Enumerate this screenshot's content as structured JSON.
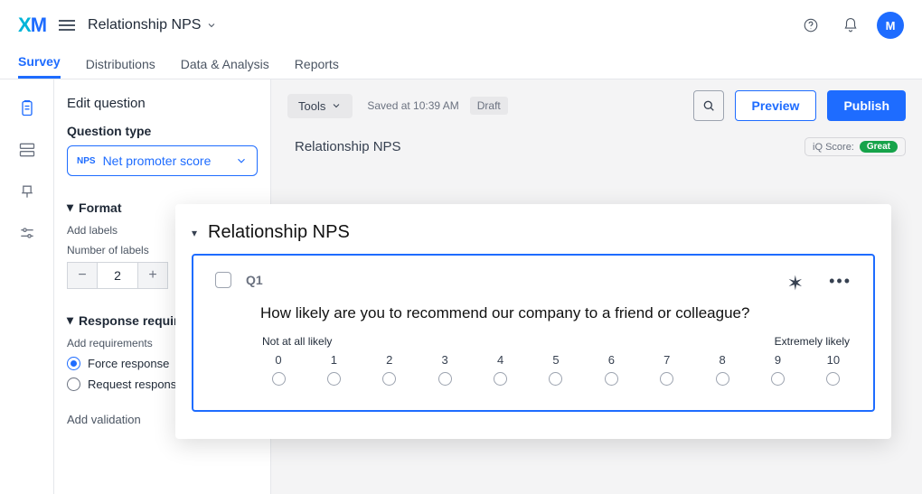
{
  "header": {
    "logo": "XM",
    "project_name": "Relationship NPS",
    "avatar_initial": "M"
  },
  "tabs": {
    "survey": "Survey",
    "distributions": "Distributions",
    "data": "Data & Analysis",
    "reports": "Reports"
  },
  "left": {
    "title": "Edit question",
    "qtype_label": "Question type",
    "qtype_tag": "NPS",
    "qtype_value": "Net promoter score",
    "format_head": "Format",
    "add_labels": "Add labels",
    "num_labels_label": "Number of labels",
    "num_labels_value": "2",
    "resp_req_head": "Response requirements",
    "add_requirements": "Add requirements",
    "force": "Force response",
    "request": "Request response",
    "add_validation": "Add validation"
  },
  "toolbar": {
    "tools": "Tools",
    "saved": "Saved at 10:39 AM",
    "draft": "Draft",
    "preview": "Preview",
    "publish": "Publish"
  },
  "survey": {
    "title": "Relationship NPS",
    "iq_label": "iQ Score:",
    "iq_value": "Great"
  },
  "overlay": {
    "block_title": "Relationship NPS",
    "qnum": "Q1",
    "qtext": "How likely are you to recommend our company to a friend or colleague?",
    "anchor_low": "Not at all likely",
    "anchor_high": "Extremely likely",
    "points": [
      "0",
      "1",
      "2",
      "3",
      "4",
      "5",
      "6",
      "7",
      "8",
      "9",
      "10"
    ]
  }
}
